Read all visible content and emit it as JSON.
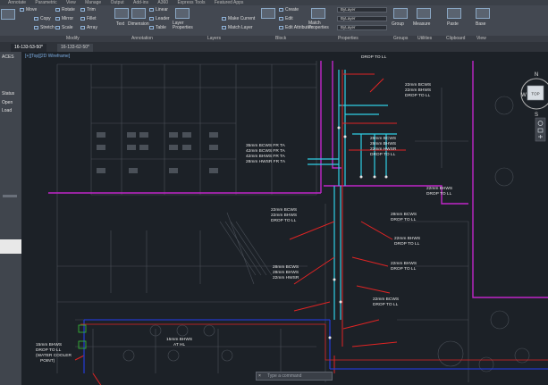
{
  "menubar": [
    "Annotate",
    "Parametric",
    "View",
    "Manage",
    "Output",
    "Add-ins",
    "A360",
    "Express Tools",
    "Featured Apps"
  ],
  "modify": {
    "move": "Move",
    "rotate": "Rotate",
    "trim": "Trim",
    "copy": "Copy",
    "mirror": "Mirror",
    "fillet": "Fillet",
    "stretch": "Stretch",
    "scale": "Scale",
    "array": "Array"
  },
  "annotation": {
    "text": "Text",
    "dimension": "Dimension",
    "linear": "Linear",
    "leader": "Leader",
    "table": "Table"
  },
  "layers": {
    "layer_properties": "Layer Properties",
    "make_current": "Make Current",
    "match_layer": "Match Layer"
  },
  "block": {
    "create": "Create",
    "edit": "Edit",
    "edit_attributes": "Edit Attributes",
    "insert": "Insert"
  },
  "properties": {
    "match_properties": "Match Properties",
    "bylayer_1": "ByLayer",
    "bylayer_2": "ByLayer",
    "bylayer_3": "ByLayer"
  },
  "groups": {
    "group": "Group"
  },
  "utilities": {
    "measure": "Measure"
  },
  "clipboard": {
    "paste": "Paste"
  },
  "view_btn": {
    "base": "Base"
  },
  "panel_labels": {
    "modify": "Modify",
    "annotation": "Annotation",
    "layers": "Layers",
    "block": "Block",
    "properties": "Properties",
    "groups": "Groups",
    "utilities": "Utilities",
    "clipboard": "Clipboard",
    "view": "View"
  },
  "tabs": [
    "16-133-53-50*",
    "16-133-62-50*"
  ],
  "sidebar": {
    "top_label": "ACES",
    "status": "Status",
    "open": "Open",
    "load": "Load"
  },
  "viewport": {
    "label": "[+][Top][2D Wireframe]"
  },
  "viewcube": {
    "n": "N",
    "w": "W",
    "e": "E",
    "s": "S",
    "top": "TOP"
  },
  "command": {
    "placeholder": "Type a command"
  },
  "annotations": {
    "drop_top": [
      "DROP TO LL"
    ],
    "a1": [
      "22mm BCWS",
      "22mm BHWS",
      "DROP TO LL"
    ],
    "a2": [
      "35mm BCWS FR TA",
      "42mm BCWS FR TA",
      "42mm BHWS FR TA",
      "28mm HWSR FR TA"
    ],
    "a3": [
      "28mm BCWS",
      "28mm BHWS",
      "22mm HWSR",
      "DROP TO LL"
    ],
    "a4": [
      "22mm BHWS",
      "DROP TO LL"
    ],
    "a5": [
      "22mm BCWS",
      "22mm BHWS",
      "DROP TO LL"
    ],
    "a6": [
      "28mm BCWS",
      "DROP TO LL"
    ],
    "a7": [
      "22mm BHWS",
      "DROP TO LL"
    ],
    "a8": [
      "22mm BHWS",
      "DROP TO LL"
    ],
    "a9": [
      "28mm BCWS",
      "28mm BHWS",
      "22mm HWSR"
    ],
    "a10": [
      "22mm BCWS",
      "DROP TO LL"
    ],
    "a11": [
      "15mm BHWS",
      "AT HL"
    ],
    "a12": [
      "15mm BHWS",
      "DROP TO LL",
      "(WATER COOLER",
      "POINT)"
    ]
  },
  "colors": {
    "drawing_bg": "#1c2127",
    "ribbon": "#434851",
    "magenta": "#c026c8",
    "cyan": "#2fd0e6",
    "red": "#e02424",
    "blue": "#2238c8",
    "green": "#38c238"
  }
}
